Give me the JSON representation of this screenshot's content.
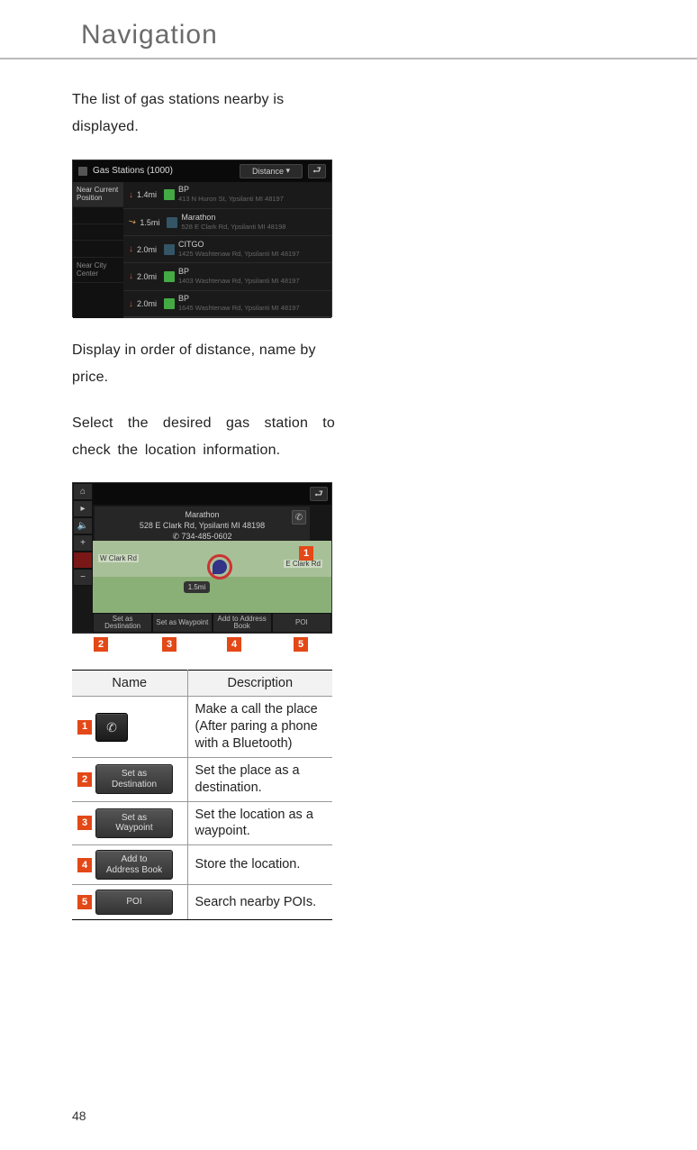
{
  "header": {
    "title": "Navigation"
  },
  "page_number": "48",
  "text": {
    "p1": "The list of gas stations nearby is displayed.",
    "p2": "Display in order of distance, name by price.",
    "p3": "Select the desired gas station to check the location information."
  },
  "screen1": {
    "title": "Gas Stations (1000)",
    "sort_label": "Distance",
    "sidebar": {
      "near_current": "Near Current Position",
      "near_city": "Near City Center"
    },
    "rows": [
      {
        "dist": "1.4mi",
        "name": "BP",
        "addr": "413 N Huron St, Ypsilanti MI 48197"
      },
      {
        "dist": "1.5mi",
        "name": "Marathon",
        "addr": "528 E Clark Rd, Ypsilanti MI 48198"
      },
      {
        "dist": "2.0mi",
        "name": "CITGO",
        "addr": "1425 Washtenaw Rd, Ypsilanti MI 48197"
      },
      {
        "dist": "2.0mi",
        "name": "BP",
        "addr": "1403 Washtenaw Rd, Ypsilanti MI 48197"
      },
      {
        "dist": "2.0mi",
        "name": "BP",
        "addr": "1645 Washtenaw Rd, Ypsilanti MI 48197"
      }
    ]
  },
  "screen2": {
    "place_name": "Marathon",
    "place_addr": "528 E Clark Rd, Ypsilanti MI 48198",
    "place_phone": "✆ 734-485-0602",
    "road1": "E Clark Rd",
    "road2": "W Clark Rd",
    "bubble": "1.5mi",
    "bottom_buttons": [
      "Set as Destination",
      "Set as Waypoint",
      "Add to Address Book",
      "POI"
    ]
  },
  "callout_numbers": [
    "2",
    "3",
    "4",
    "5"
  ],
  "callout_on_screen": "1",
  "legend": {
    "head_name": "Name",
    "head_desc": "Description",
    "rows": [
      {
        "num": "1",
        "btn": "phone",
        "desc": "Make a call the place (After paring a phone with a Bluetooth)"
      },
      {
        "num": "2",
        "btn": "Set as\nDestination",
        "desc": "Set the place as a destination."
      },
      {
        "num": "3",
        "btn": "Set as\nWaypoint",
        "desc": "Set the location as a waypoint."
      },
      {
        "num": "4",
        "btn": "Add to\nAddress Book",
        "desc": "Store the location."
      },
      {
        "num": "5",
        "btn": "POI",
        "desc": "Search nearby POIs."
      }
    ]
  }
}
